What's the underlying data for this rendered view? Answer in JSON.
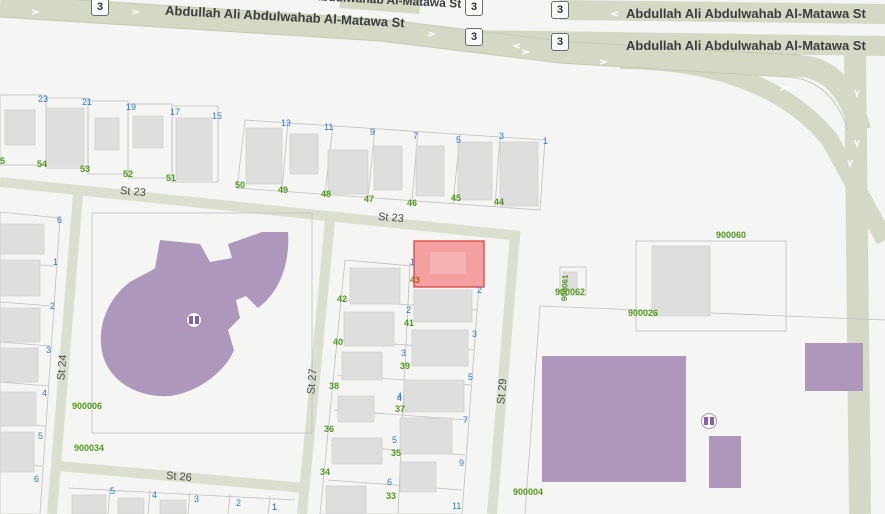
{
  "highways": {
    "name": "Abdullah Ali Abdulwahab Al-Matawa St",
    "shield_number": "3",
    "partial_top": "Abdullah Ali Abdulwahab Al-Matawa St"
  },
  "streets": {
    "st23_a": "St 23",
    "st23_b": "St 23",
    "st24": "St 24",
    "st26": "St 26",
    "st27": "St 27",
    "st29": "St 29"
  },
  "plots_blue": [
    "23",
    "21",
    "19",
    "17",
    "15",
    "13",
    "11",
    "9",
    "7",
    "5",
    "3",
    "1",
    "6",
    "1",
    "2",
    "3",
    "4",
    "5",
    "6",
    "1",
    "2",
    "3",
    "4",
    "5",
    "6",
    "7",
    "9",
    "11",
    "2",
    "3",
    "4",
    "5",
    "1",
    "5",
    "4",
    "3",
    "2",
    "1"
  ],
  "plots_green": [
    "5",
    "54",
    "53",
    "52",
    "51",
    "50",
    "49",
    "48",
    "47",
    "46",
    "45",
    "44",
    "43",
    "42",
    "41",
    "40",
    "39",
    "38",
    "37",
    "36",
    "35",
    "34",
    "33"
  ],
  "parcels": {
    "p900060": "900060",
    "p900061": "900061",
    "p900062": "900062",
    "p900026": "900026",
    "p900006": "900006",
    "p900034": "900034",
    "p900004": "900004"
  },
  "colors": {
    "background": "#f5f5f4",
    "highway": "#d6dbc8",
    "street": "#dadfcf",
    "building": "#dededf",
    "mosque": "#ad98bb",
    "highlight": "#f5a0a0",
    "highlight_border": "#d93b3b",
    "plot_blue": "#2c7bd6",
    "plot_green": "#4f9a1c"
  },
  "icons": [
    "mosque-icon",
    "highway-shield-icon",
    "direction-arrow-icon"
  ]
}
